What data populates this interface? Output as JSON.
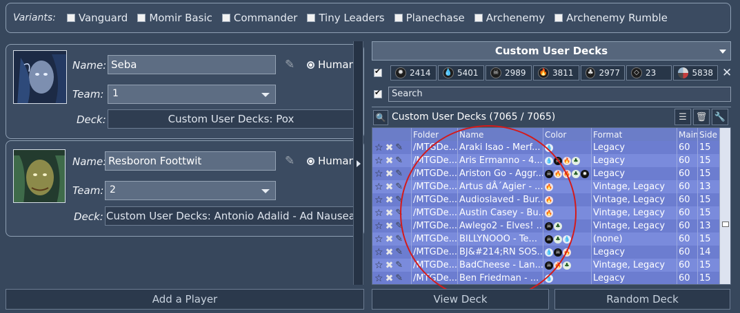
{
  "variants": {
    "label": "Variants:",
    "items": [
      {
        "label": "Vanguard",
        "checked": false
      },
      {
        "label": "Momir Basic",
        "checked": false
      },
      {
        "label": "Commander",
        "checked": false
      },
      {
        "label": "Tiny Leaders",
        "checked": false
      },
      {
        "label": "Planechase",
        "checked": false
      },
      {
        "label": "Archenemy",
        "checked": false
      },
      {
        "label": "Archenemy Rumble",
        "checked": false
      }
    ]
  },
  "players": [
    {
      "name_label": "Name:",
      "name": "Seba",
      "team_label": "Team:",
      "team": "1",
      "deck_label": "Deck:",
      "deck": "Custom User Decks: Pox",
      "type": "Human"
    },
    {
      "name_label": "Name:",
      "name": "Resboron Foottwit",
      "team_label": "Team:",
      "team": "2",
      "deck_label": "Deck:",
      "deck": "Custom User Decks: Antonio Adalid - Ad Nauseam Te",
      "type": "Human"
    }
  ],
  "buttons": {
    "add_player": "Add a Player",
    "view_deck": "View Deck",
    "random_deck": "Random Deck"
  },
  "deck_chooser": {
    "header": "Custom User Decks",
    "color_filters": [
      {
        "icon": "white-mana-icon",
        "count": "2414"
      },
      {
        "icon": "blue-mana-icon",
        "count": "5401"
      },
      {
        "icon": "black-mana-icon",
        "count": "2989"
      },
      {
        "icon": "red-mana-icon",
        "count": "3811"
      },
      {
        "icon": "green-mana-icon",
        "count": "2977"
      },
      {
        "icon": "colorless-mana-icon",
        "count": "23"
      },
      {
        "icon": "multicolor-icon",
        "count": "5838"
      }
    ],
    "search_placeholder": "Search",
    "list_title": "Custom User Decks (7065 / 7065)",
    "columns": {
      "folder": "Folder",
      "name": "Name",
      "color": "Color",
      "format": "Format",
      "main": "Main",
      "side": "Side"
    },
    "rows": [
      {
        "folder": "/MTGDe...",
        "name": "Araki Isao - Merf...",
        "colors": [
          "blue"
        ],
        "format": "Legacy",
        "main": "60",
        "side": "15"
      },
      {
        "folder": "/MTGDe...",
        "name": "Aris Ermanno - 4...",
        "colors": [
          "blue",
          "black",
          "red",
          "green"
        ],
        "format": "Legacy",
        "main": "60",
        "side": "15"
      },
      {
        "folder": "/MTGDe...",
        "name": "Ariston Go - Aggr...",
        "colors": [
          "black",
          "red",
          "red",
          "green",
          "white"
        ],
        "format": "Legacy",
        "main": "60",
        "side": "15"
      },
      {
        "folder": "/MTGDe...",
        "name": "Artus dÂ´Agier - ...",
        "colors": [
          "red"
        ],
        "format": "Vintage, Legacy",
        "main": "60",
        "side": "13"
      },
      {
        "folder": "/MTGDe...",
        "name": "Audioslaved - Bur...",
        "colors": [
          "red"
        ],
        "format": "Vintage, Legacy",
        "main": "60",
        "side": "15"
      },
      {
        "folder": "/MTGDe...",
        "name": "Austin Casey - Bu...",
        "colors": [
          "red"
        ],
        "format": "Vintage, Legacy",
        "main": "60",
        "side": "15"
      },
      {
        "folder": "/MTGDe...",
        "name": "Awlego2 - Elves! ...",
        "colors": [
          "black",
          "green"
        ],
        "format": "Vintage, Legacy",
        "main": "60",
        "side": "13"
      },
      {
        "folder": "/MTGDe...",
        "name": "BILLYNOOO - Te...",
        "colors": [
          "black",
          "green",
          "blue"
        ],
        "format": "(none)",
        "main": "60",
        "side": "15"
      },
      {
        "folder": "/MTGDe...",
        "name": "BJ&#214;RN SOS...",
        "colors": [
          "blue",
          "black",
          "red"
        ],
        "format": "Legacy",
        "main": "60",
        "side": "14"
      },
      {
        "folder": "/MTGDe...",
        "name": "BadCheese - Lan...",
        "colors": [
          "black",
          "red",
          "green"
        ],
        "format": "Vintage, Legacy",
        "main": "60",
        "side": "15"
      },
      {
        "folder": "/MTGDe...",
        "name": "Ben Friedman - ...",
        "colors": [
          "blue"
        ],
        "format": "Legacy",
        "main": "60",
        "side": "15"
      }
    ]
  },
  "colors": {
    "annotation": "#d41a1a",
    "background": "#37475c",
    "table": "#7e8fd8"
  }
}
